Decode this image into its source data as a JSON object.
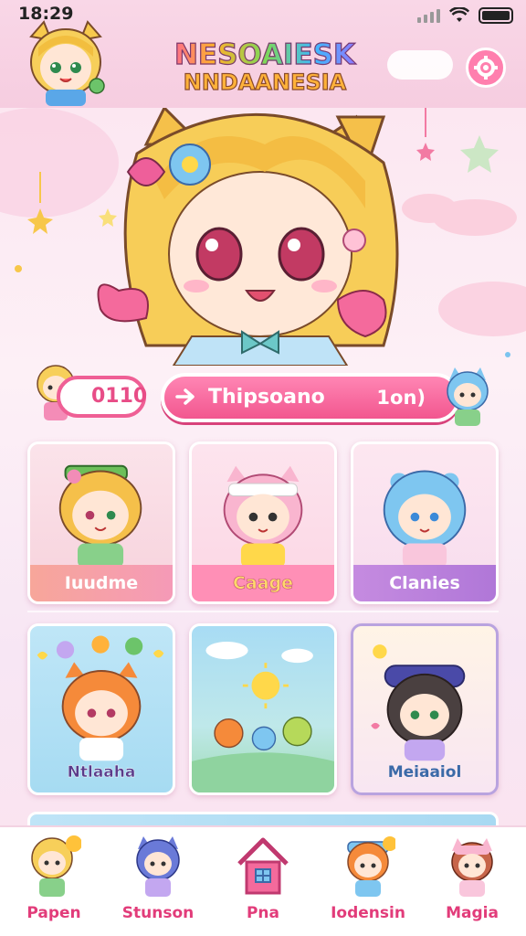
{
  "status_bar": {
    "time": "18:29"
  },
  "header": {
    "logo_line1": "NESOAIESK",
    "logo_line2": "NNDAANESIA",
    "settings_icon": "gear-icon"
  },
  "progress": {
    "score": "0110",
    "name": "Thipsoano",
    "time": "1on)"
  },
  "cards": [
    {
      "label": "Iuudme",
      "footer_color": "#f6a2a8",
      "label_color": "#ffffff"
    },
    {
      "label": "Caage",
      "footer_color": "#ff8fb6",
      "label_color": "#ffd86b"
    },
    {
      "label": "Clanies",
      "footer_color": "#c58be0",
      "label_color": "#ffffff"
    },
    {
      "label": "Ntlaaha",
      "footer_color": "",
      "label_color": "#5a3b8a"
    },
    {
      "label": "",
      "footer_color": "",
      "label_color": ""
    },
    {
      "label": "Meiaaiol",
      "footer_color": "",
      "label_color": "#3b6aa8"
    }
  ],
  "nav": [
    {
      "label": "Papen"
    },
    {
      "label": "Stunson"
    },
    {
      "label": "Pna"
    },
    {
      "label": "Iodensin"
    },
    {
      "label": "Magia"
    }
  ],
  "colors": {
    "accent": "#f2568f",
    "nav_label": "#e23c7a"
  }
}
